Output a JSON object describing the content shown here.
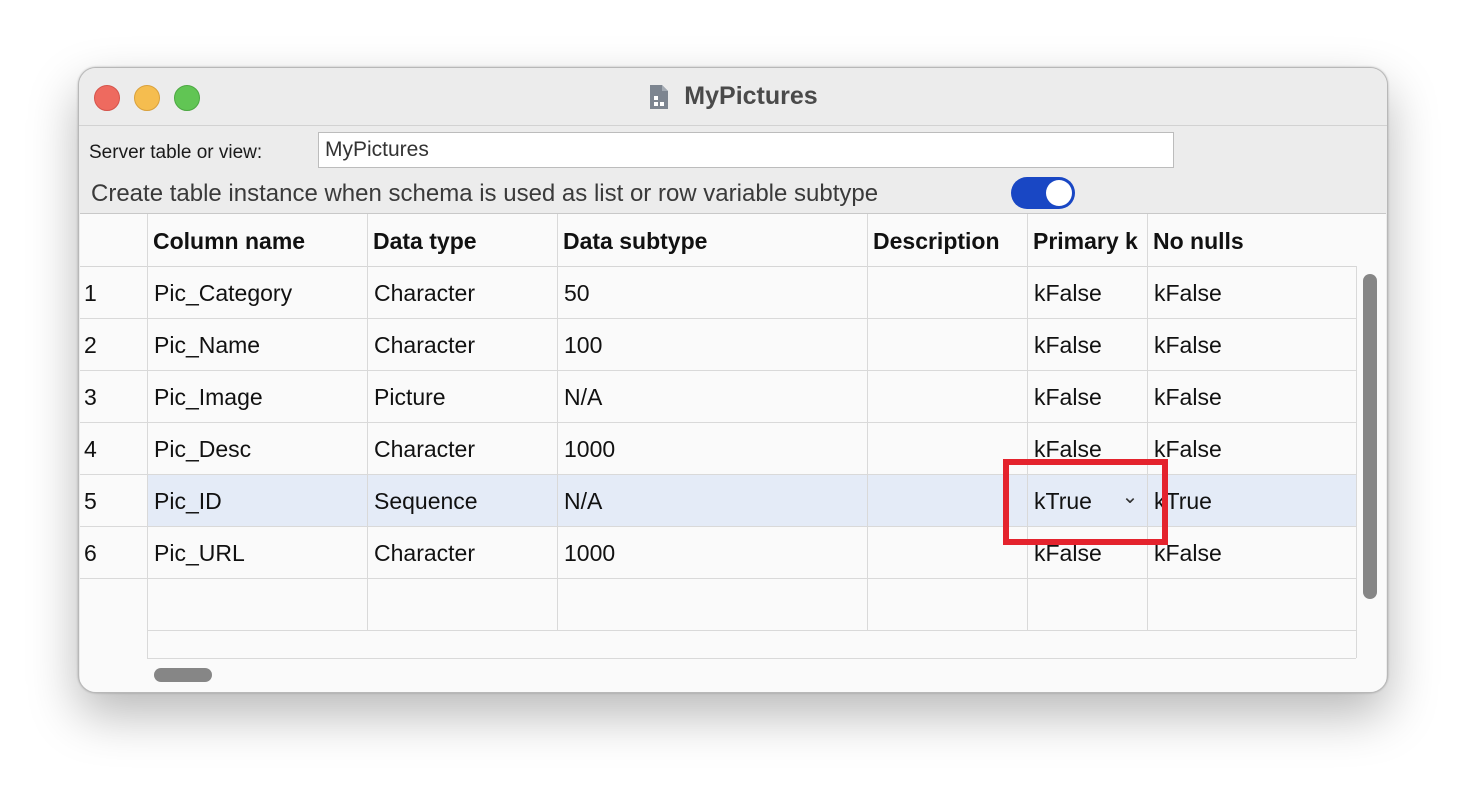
{
  "window": {
    "title": "MyPictures",
    "icon": "document-table-icon"
  },
  "form": {
    "server_table_label": "Server table or view:",
    "server_table_value": "MyPictures",
    "create_instance_label": "Create table instance when schema is used as list or row variable subtype",
    "create_instance_on": true
  },
  "table": {
    "headers": [
      "Column name",
      "Data type",
      "Data subtype",
      "Description",
      "Primary k",
      "No nulls"
    ],
    "rows": [
      {
        "num": "1",
        "name": "Pic_Category",
        "type": "Character",
        "subtype": "50",
        "description": "",
        "primary": "kFalse",
        "nonulls": "kFalse"
      },
      {
        "num": "2",
        "name": "Pic_Name",
        "type": "Character",
        "subtype": "100",
        "description": "",
        "primary": "kFalse",
        "nonulls": "kFalse"
      },
      {
        "num": "3",
        "name": "Pic_Image",
        "type": "Picture",
        "subtype": "N/A",
        "description": "",
        "primary": "kFalse",
        "nonulls": "kFalse"
      },
      {
        "num": "4",
        "name": "Pic_Desc",
        "type": "Character",
        "subtype": "1000",
        "description": "",
        "primary": "kFalse",
        "nonulls": "kFalse"
      },
      {
        "num": "5",
        "name": "Pic_ID",
        "type": "Sequence",
        "subtype": "N/A",
        "description": "",
        "primary": "kTrue",
        "nonulls": "kTrue"
      },
      {
        "num": "6",
        "name": "Pic_URL",
        "type": "Character",
        "subtype": "1000",
        "description": "",
        "primary": "kFalse",
        "nonulls": "kFalse"
      }
    ],
    "selected_row": "5",
    "dropdown_icon": "chevron-down-icon"
  },
  "colors": {
    "toggle_on": "#1947c4",
    "selection": "#e4ebf7",
    "highlight": "#e4232d"
  }
}
